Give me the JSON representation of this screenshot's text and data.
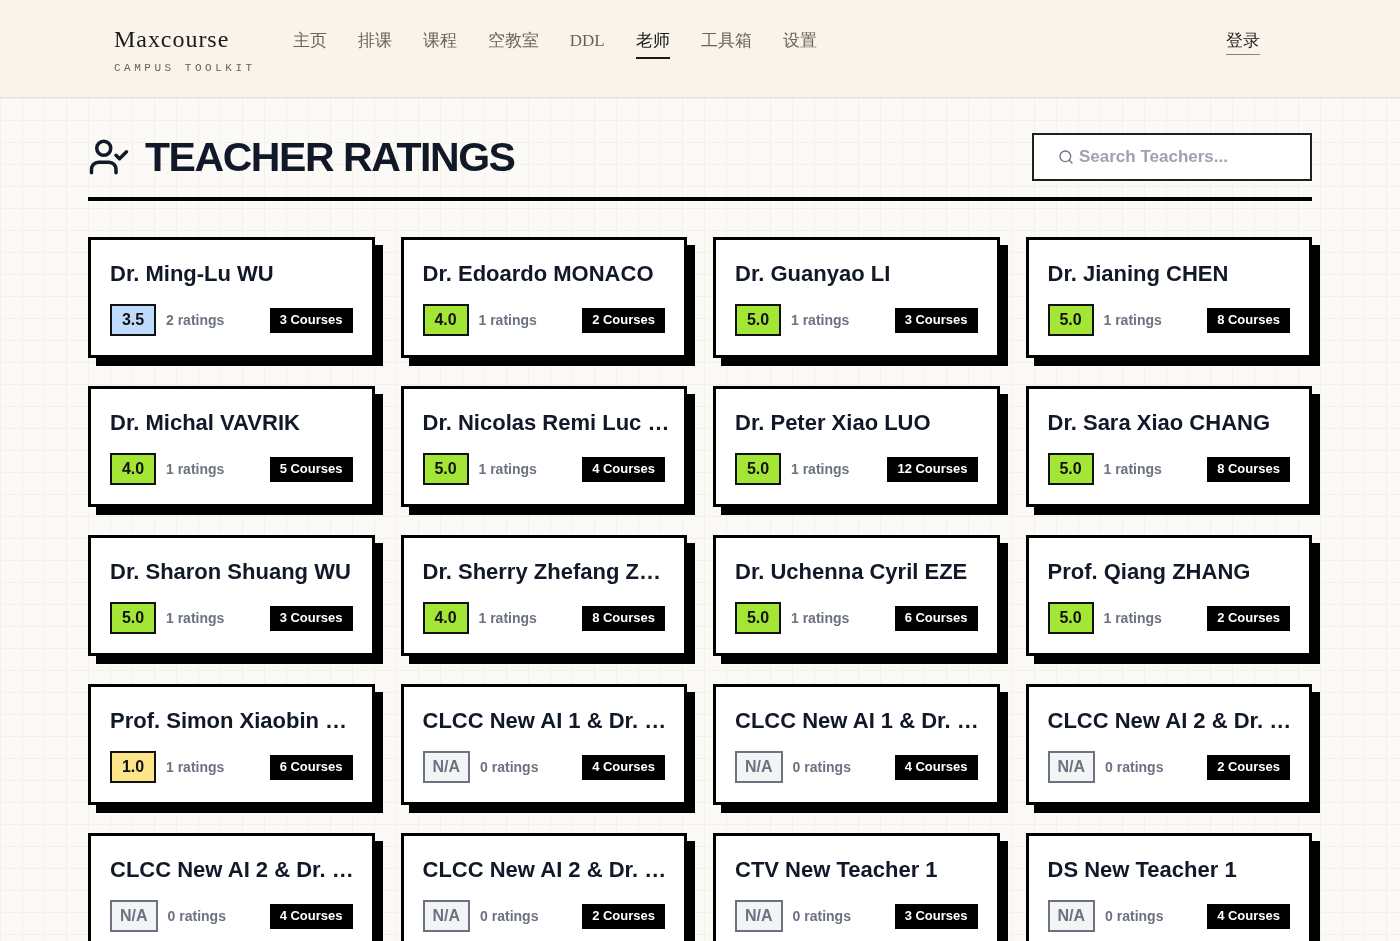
{
  "header": {
    "logo": "Maxcourse",
    "tagline": "CAMPUS TOOLKIT",
    "nav": [
      {
        "label": "主页",
        "selected": false
      },
      {
        "label": "排课",
        "selected": false
      },
      {
        "label": "课程",
        "selected": false
      },
      {
        "label": "空教室",
        "selected": false
      },
      {
        "label": "DDL",
        "selected": false
      },
      {
        "label": "老师",
        "selected": true
      },
      {
        "label": "工具箱",
        "selected": false
      },
      {
        "label": "设置",
        "selected": false
      }
    ],
    "login": "登录"
  },
  "page": {
    "title": "TEACHER RATINGS",
    "search": {
      "placeholder": "Search Teachers..."
    }
  },
  "teachers": [
    {
      "name": "Dr. Ming-Lu WU",
      "rating": "3.5",
      "rated": true,
      "color": "#bfdbfe",
      "ratings": "2 ratings",
      "courses": "3 Courses"
    },
    {
      "name": "Dr. Edoardo MONACO",
      "rating": "4.0",
      "rated": true,
      "color": "#a3e635",
      "ratings": "1 ratings",
      "courses": "2 Courses"
    },
    {
      "name": "Dr. Guanyao LI",
      "rating": "5.0",
      "rated": true,
      "color": "#a3e635",
      "ratings": "1 ratings",
      "courses": "3 Courses"
    },
    {
      "name": "Dr. Jianing CHEN",
      "rating": "5.0",
      "rated": true,
      "color": "#a3e635",
      "ratings": "1 ratings",
      "courses": "8 Courses"
    },
    {
      "name": "Dr. Michal VAVRIK",
      "rating": "4.0",
      "rated": true,
      "color": "#a3e635",
      "ratings": "1 ratings",
      "courses": "5 Courses"
    },
    {
      "name": "Dr. Nicolas Remi Luc …",
      "rating": "5.0",
      "rated": true,
      "color": "#a3e635",
      "ratings": "1 ratings",
      "courses": "4 Courses"
    },
    {
      "name": "Dr. Peter Xiao LUO",
      "rating": "5.0",
      "rated": true,
      "color": "#a3e635",
      "ratings": "1 ratings",
      "courses": "12 Courses"
    },
    {
      "name": "Dr. Sara Xiao CHANG",
      "rating": "5.0",
      "rated": true,
      "color": "#a3e635",
      "ratings": "1 ratings",
      "courses": "8 Courses"
    },
    {
      "name": "Dr. Sharon Shuang WU",
      "rating": "5.0",
      "rated": true,
      "color": "#a3e635",
      "ratings": "1 ratings",
      "courses": "3 Courses"
    },
    {
      "name": "Dr. Sherry Zhefang Z…",
      "rating": "4.0",
      "rated": true,
      "color": "#a3e635",
      "ratings": "1 ratings",
      "courses": "8 Courses"
    },
    {
      "name": "Dr. Uchenna Cyril EZE",
      "rating": "5.0",
      "rated": true,
      "color": "#a3e635",
      "ratings": "1 ratings",
      "courses": "6 Courses"
    },
    {
      "name": "Prof. Qiang ZHANG",
      "rating": "5.0",
      "rated": true,
      "color": "#a3e635",
      "ratings": "1 ratings",
      "courses": "2 Courses"
    },
    {
      "name": "Prof. Simon Xiaobin …",
      "rating": "1.0",
      "rated": true,
      "color": "#fde68a",
      "ratings": "1 ratings",
      "courses": "6 Courses"
    },
    {
      "name": "CLCC New AI 1 & Dr. …",
      "rating": "N/A",
      "rated": false,
      "color": "#f3f4f6",
      "ratings": "0 ratings",
      "courses": "4 Courses"
    },
    {
      "name": "CLCC New AI 1 & Dr. …",
      "rating": "N/A",
      "rated": false,
      "color": "#f3f4f6",
      "ratings": "0 ratings",
      "courses": "4 Courses"
    },
    {
      "name": "CLCC New AI 2 & Dr. …",
      "rating": "N/A",
      "rated": false,
      "color": "#f3f4f6",
      "ratings": "0 ratings",
      "courses": "2 Courses"
    },
    {
      "name": "CLCC New AI 2 & Dr. …",
      "rating": "N/A",
      "rated": false,
      "color": "#f3f4f6",
      "ratings": "0 ratings",
      "courses": "4 Courses"
    },
    {
      "name": "CLCC New AI 2 & Dr. …",
      "rating": "N/A",
      "rated": false,
      "color": "#f3f4f6",
      "ratings": "0 ratings",
      "courses": "2 Courses"
    },
    {
      "name": "CTV New Teacher 1",
      "rating": "N/A",
      "rated": false,
      "color": "#f3f4f6",
      "ratings": "0 ratings",
      "courses": "3 Courses"
    },
    {
      "name": "DS New Teacher 1",
      "rating": "N/A",
      "rated": false,
      "color": "#f3f4f6",
      "ratings": "0 ratings",
      "courses": "4 Courses"
    }
  ]
}
